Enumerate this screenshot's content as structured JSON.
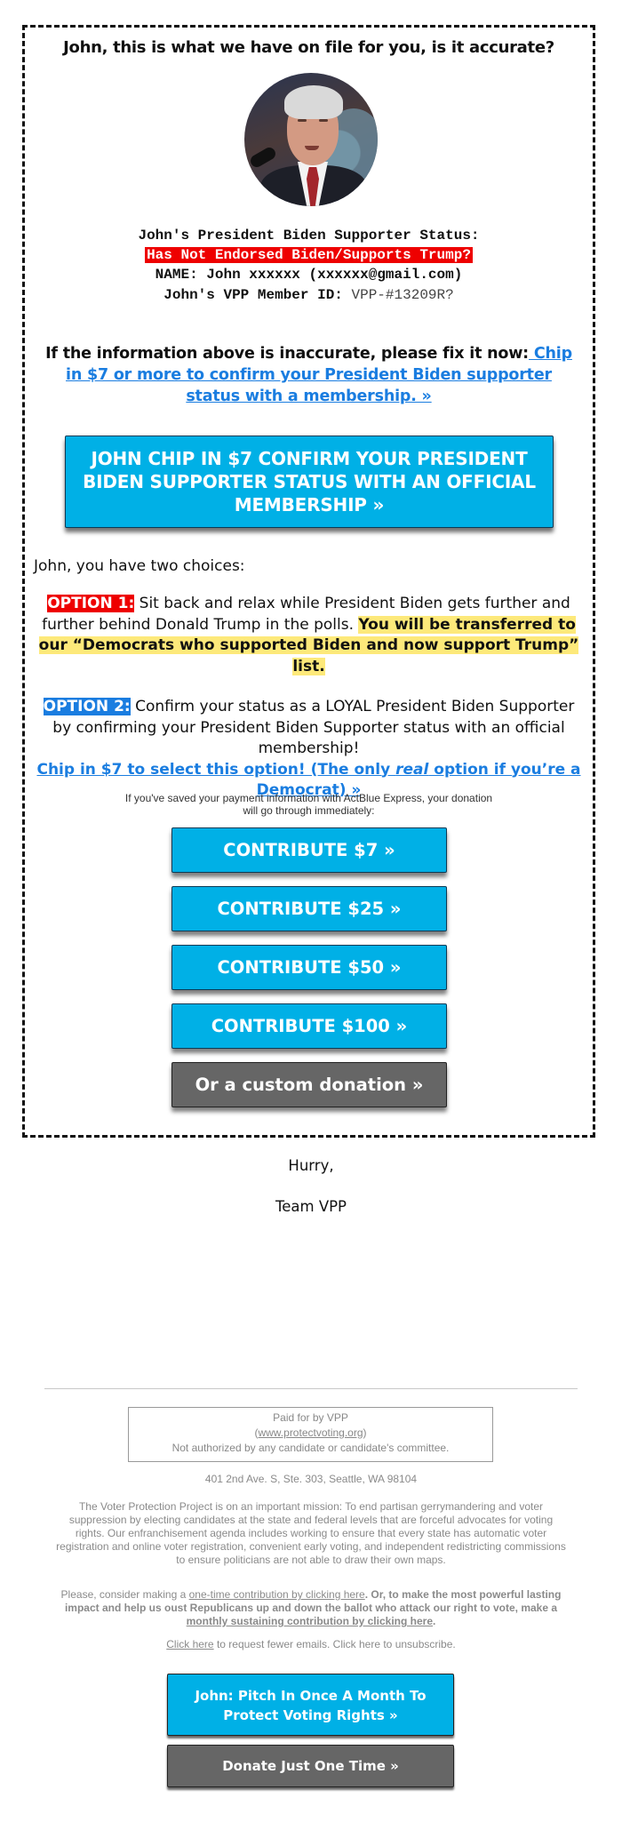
{
  "header": {
    "headline": "John, this is what we have on file for you, is it accurate?",
    "photo_alt": "President Biden photo"
  },
  "profile": {
    "status_label": "John's President Biden Supporter Status:",
    "status_value": "Has Not Endorsed Biden/Supports Trump?",
    "name_line": "NAME: John xxxxxx (xxxxxx@gmail.com)",
    "member_label": "John's VPP Member ID: ",
    "member_id": "VPP-#13209R?"
  },
  "fix": {
    "text": "If the information above is inaccurate, please fix it now:",
    "link": " Chip in $7 or more to confirm your President Biden supporter status with a membership. »"
  },
  "cta_big": {
    "label": "JOHN CHIP IN $7 CONFIRM YOUR PRESIDENT BIDEN SUPPORTER STATUS WITH AN OFFICIAL MEMBERSHIP »"
  },
  "choices": {
    "intro": "John, you have two choices:",
    "option1": {
      "tag": "OPTION 1:",
      "text": " Sit back and relax while President Biden gets further and further behind Donald Trump in the polls. ",
      "highlight": "You will be transferred to our “Democrats who supported Biden and now support Trump” list."
    },
    "option2": {
      "tag": "OPTION 2:",
      "text": " Confirm your status as a LOYAL President Biden Supporter by confirming your President Biden Supporter status with an official membership!",
      "link_part1": "Chip in $7 to select this option! (The only ",
      "link_italic": "real",
      "link_part2": " option if you’re a Democrat) »"
    }
  },
  "actblue": {
    "line1": "If you've saved your payment information with ActBlue Express, your donation",
    "line2": "will go through immediately:"
  },
  "donate_buttons": [
    {
      "label": "CONTRIBUTE $7 »",
      "color": "#00b0e6"
    },
    {
      "label": "CONTRIBUTE $25 »",
      "color": "#00b0e6"
    },
    {
      "label": "CONTRIBUTE $50 »",
      "color": "#00b0e6"
    },
    {
      "label": "CONTRIBUTE $100 »",
      "color": "#00b0e6"
    },
    {
      "label": "Or a custom donation »",
      "color": "#666666"
    }
  ],
  "signoff": {
    "hurry": "Hurry,",
    "team": "Team VPP"
  },
  "footer": {
    "paid_for": "Paid for by VPP",
    "url_open": "(",
    "url": "www.protectvoting.org",
    "url_close": ")",
    "not_authorized": "Not authorized by any candidate or candidate's committee.",
    "address": "401 2nd Ave. S, Ste. 303, Seattle, WA 98104",
    "mission": "The Voter Protection Project is on an important mission: To end partisan gerrymandering and voter suppression by electing candidates at the state and federal levels that are forceful advocates for voting rights. Our enfranchisement agenda includes working to ensure that every state has automatic voter registration and online voter registration, convenient early voting, and independent redistricting commissions to ensure politicians are not able to draw their own maps.",
    "consider_pre": "Please, consider making a ",
    "consider_link": "one-time contribution by clicking here",
    "consider_bold": ". Or, to make the most powerful lasting impact and help us oust Republicans up and down the ballot who attack our right to vote, make a ",
    "monthly_link": "monthly sustaining contribution by clicking here",
    "consider_end": ".",
    "fewer_link": "Click here",
    "fewer_text": " to request fewer emails. Click here to unsubscribe.",
    "monthly_button": "John: Pitch In Once A Month To Protect Voting Rights »",
    "onetime_button": "Donate Just One Time »"
  },
  "colors": {
    "accent_blue": "#00b0e6",
    "link_blue": "#1a7de0",
    "alert_red": "#ee0000",
    "highlight_yellow": "#fde97a",
    "button_gray": "#666666"
  }
}
